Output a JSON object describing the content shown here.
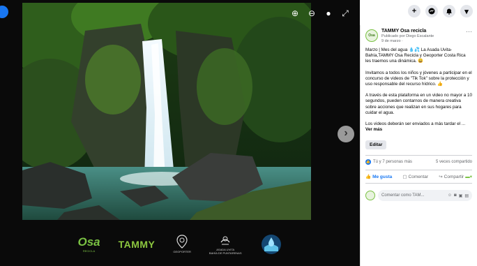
{
  "viewer": {
    "tools": [
      {
        "name": "zoom-in-icon",
        "glyph": "⊕"
      },
      {
        "name": "zoom-out-icon",
        "glyph": "⊖"
      },
      {
        "name": "tag-icon",
        "glyph": "●"
      },
      {
        "name": "fullscreen-icon",
        "glyph": "⤢"
      }
    ],
    "next_glyph": "›"
  },
  "logos": {
    "osa": "Osa",
    "osa_sub": "RECICLA",
    "tammy": "TAMMY",
    "geoporter": "GEOPORTER",
    "asada": "ASADA UVITA\nBAHÍA DE PUNTARENAS"
  },
  "top_buttons": [
    {
      "name": "add-icon",
      "glyph": "+"
    },
    {
      "name": "messenger-icon",
      "glyph": "◉"
    },
    {
      "name": "notifications-icon",
      "glyph": "♦"
    },
    {
      "name": "account-menu-icon",
      "glyph": "▾"
    }
  ],
  "post": {
    "avatar_text": "Osa",
    "page_name": "TAMMY Osa recicla",
    "published_by": "Publicado por Diego Escalante",
    "date": "9 de marzo ·",
    "paragraphs": [
      "Marzo | Mes del agua 💧💦 La Asada Uvita-Bahía,TAMMY Osa Recicla y Geoporter Costa Rica les traemos una dinámica. 😀",
      "Invitamos a todos los niños y jóvenes a participar en el concurso de videos de \"Tik Tok\" sobre la protección y uso responsable del recurso hídrico. 👍",
      "A través de esta plataforma en un video no mayor a 10 segundos, pueden contarnos de manera creativa sobre acciones que realizan en sus hogares para cuidar el agua."
    ],
    "last_line": "Los videos deberán ser enviados a más tardar el ...",
    "see_more": "Ver más",
    "edit_label": "Editar",
    "reactions_text": "Tú y 7 personas más",
    "shares_text": "5 veces compartido",
    "like_label": "Me gusta",
    "comment_label": "Comentar",
    "share_label": "Compartir",
    "comment_placeholder": "Comentar como TAM..."
  },
  "colors": {
    "accent": "#1877f2",
    "brand_green": "#7ac143"
  }
}
